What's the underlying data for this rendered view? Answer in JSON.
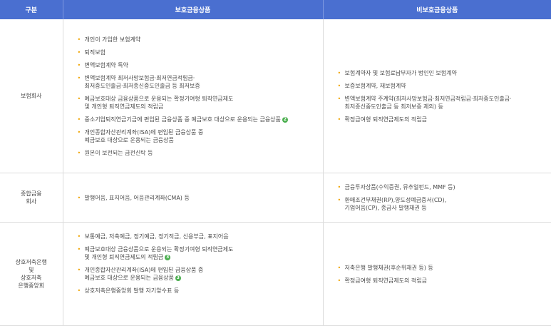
{
  "headers": [
    "구분",
    "보호금융상품",
    "비보호금융상품"
  ],
  "rows": [
    {
      "category": "보험회사",
      "protected": [
        {
          "text": "개인이 가입한 보험계약"
        },
        {
          "text": "퇴직보험"
        },
        {
          "text": "변액보험계약 특약"
        },
        {
          "text": "변액보험계약 최저사망보험금·최저연금적립금·\n최저중도인출금·최저종신중도인출금 등 최저보증"
        },
        {
          "text": "예금보호대상 금융상품으로 운용되는 확정기여형 퇴직연금제도\n및 개인형 퇴직연금제도의 적립금"
        },
        {
          "text": "중소기업퇴직연금기금에 편입된 금융상품 중 예금보호 대상으로 운용되는 금융상품",
          "badge": "2"
        },
        {
          "text": "개인종합자산관리계좌(ISA)에 편입된 금융상품 중\n예금보호 대상으로 운용되는 금융상품"
        },
        {
          "text": "원본이 보전되는 금전신탁 등"
        }
      ],
      "unprotected": [
        {
          "text": "보험계약자 및 보험료납부자가 법인인 보험계약"
        },
        {
          "text": "보증보험계약, 재보험계약"
        },
        {
          "text": "변액보험계약 주계약(최저사망보험금·최저연금적립금·최저중도인출금·\n최저종신중도인출금 등 최저보증 제외) 등"
        },
        {
          "text": "확정급여형 퇴직연금제도의 적립금"
        }
      ]
    },
    {
      "category": "종합금융\n회사",
      "protected": [
        {
          "text": "발행어음, 표지어음, 어음관리계좌(CMA) 등"
        }
      ],
      "unprotected": [
        {
          "text": "금융투자상품(수익증권, 뮤추얼펀드, MMF 등)"
        },
        {
          "text": "환매조건부채권(RP),양도성예금증서(CD),\n기업어음(CP), 종금사 발행채권 등"
        }
      ]
    },
    {
      "category": "상호저축은행\n및\n상호저축\n은행중앙회",
      "protected": [
        {
          "text": "보통예금, 저축예금, 정기예금, 정기적금, 신용부금, 표지어음"
        },
        {
          "text": "예금보호대상 금융상품으로 운용되는 확정기여형 퇴직연금제도\n및 개인형 퇴직연금제도의 적립금",
          "badge": "3"
        },
        {
          "text": "개인종합자산관리계좌(ISA)에 편입된 금융상품 중\n예금보호 대상으로 운용되는 금융상품",
          "badge": "3"
        },
        {
          "text": "상호저축은행중앙회 발행 자기앞수표 등"
        }
      ],
      "unprotected": [
        {
          "text": "저축은행 발행채권(후순위채권 등) 등"
        },
        {
          "text": "확정급여형 퇴직연금제도의 적립금"
        }
      ]
    }
  ]
}
